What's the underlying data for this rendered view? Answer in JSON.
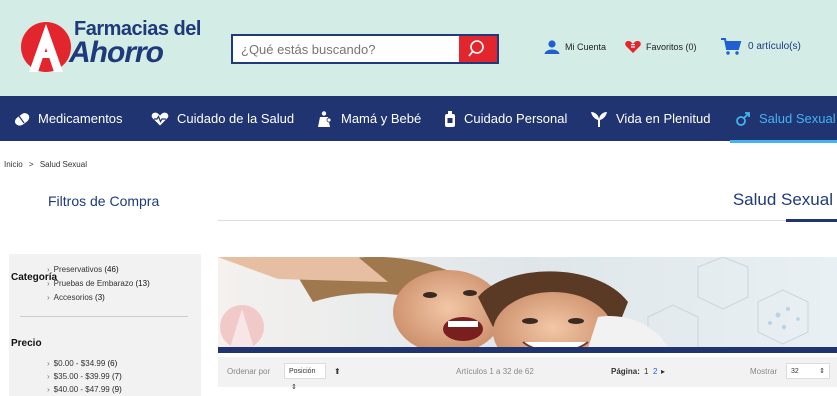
{
  "header": {
    "logo_line1": "Farmacias del",
    "logo_line2": "Ahorro",
    "search_placeholder": "¿Qué estás buscando?",
    "account_label": "Mi Cuenta",
    "favorites_label": "Favoritos (0)",
    "cart_label": "0 artículo(s)"
  },
  "nav": {
    "items": [
      {
        "label": "Medicamentos",
        "icon": "pill-icon"
      },
      {
        "label": "Cuidado de la Salud",
        "icon": "heart-pulse-icon"
      },
      {
        "label": "Mamá y Bebé",
        "icon": "mother-baby-icon"
      },
      {
        "label": "Cuidado Personal",
        "icon": "personal-care-icon"
      },
      {
        "label": "Vida en Plenitud",
        "icon": "plant-icon"
      },
      {
        "label": "Salud Sexual",
        "icon": "male-symbol-icon"
      }
    ],
    "active": "Salud Sexual"
  },
  "breadcrumb": {
    "home": "Inicio",
    "separator": ">",
    "current": "Salud Sexual"
  },
  "sidebar": {
    "title": "Filtros de Compra",
    "category_heading": "Categoría",
    "categories": [
      {
        "label": "Preservativos",
        "count": "(46)"
      },
      {
        "label": "Pruebas de Embarazo",
        "count": "(13)"
      },
      {
        "label": "Accesorios",
        "count": "(3)"
      }
    ],
    "price_heading": "Precio",
    "prices": [
      {
        "label": "$0.00 - $34.99",
        "count": "(6)"
      },
      {
        "label": "$35.00 - $39.99",
        "count": "(7)"
      },
      {
        "label": "$40.00 - $47.99",
        "count": "(9)"
      }
    ]
  },
  "main": {
    "title": "Salud Sexual",
    "toolbar": {
      "sort_label": "Ordenar por",
      "sort_value": "Posición",
      "articles": "Artículos 1 a 32 de 62",
      "page_label": "Página:",
      "page_current": "1",
      "page_next": "2",
      "show_label": "Mostrar",
      "show_value": "32"
    }
  },
  "colors": {
    "navy": "#1f3470",
    "red": "#e3262d",
    "accent": "#44b4f0",
    "header_bg": "#d3ece6"
  }
}
